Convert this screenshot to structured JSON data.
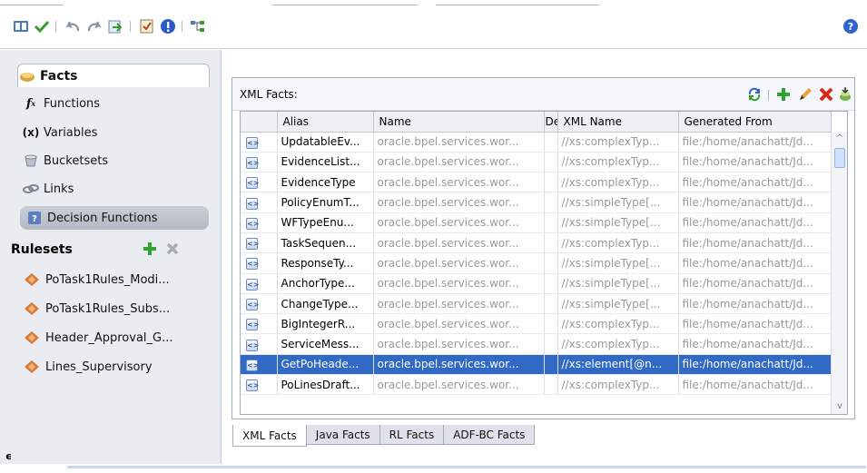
{
  "toolbar": {
    "icons": [
      "book-icon",
      "check-icon",
      "undo-icon",
      "redo-icon",
      "import-icon",
      "validate-icon",
      "info-icon",
      "tree-icon",
      "help-icon"
    ]
  },
  "sidebar": {
    "facts_label": "Facts",
    "items": [
      {
        "label": "Functions",
        "icon": "function-icon"
      },
      {
        "label": "Variables",
        "icon": "variables-icon"
      },
      {
        "label": "Bucketsets",
        "icon": "bucketsets-icon"
      },
      {
        "label": "Links",
        "icon": "links-icon"
      }
    ],
    "decision_functions_label": "Decision Functions",
    "rulesets_label": "Rulesets",
    "rulesets": [
      "PoTask1Rules_Modi...",
      "PoTask1Rules_Subs...",
      "Header_Approval_G...",
      "Lines_Supervisory"
    ],
    "status_glyph": "ϵ"
  },
  "xml_facts": {
    "label": "XML Facts:",
    "columns": [
      "",
      "Alias",
      "Name",
      "De",
      "XML Name",
      "Generated From"
    ],
    "rows": [
      {
        "alias": "UpdatableEv...",
        "name": "oracle.bpel.services.wor...",
        "xml": "//xs:complexTyp...",
        "from": "file:/home/anachatt/Jd..."
      },
      {
        "alias": "EvidenceList...",
        "name": "oracle.bpel.services.wor...",
        "xml": "//xs:complexTyp...",
        "from": "file:/home/anachatt/Jd..."
      },
      {
        "alias": "EvidenceType",
        "name": "oracle.bpel.services.wor...",
        "xml": "//xs:complexTyp...",
        "from": "file:/home/anachatt/Jd..."
      },
      {
        "alias": "PolicyEnumT...",
        "name": "oracle.bpel.services.wor...",
        "xml": "//xs:simpleType[...",
        "from": "file:/home/anachatt/Jd..."
      },
      {
        "alias": "WFTypeEnu...",
        "name": "oracle.bpel.services.wor...",
        "xml": "//xs:simpleType[...",
        "from": "file:/home/anachatt/Jd..."
      },
      {
        "alias": "TaskSequen...",
        "name": "oracle.bpel.services.wor...",
        "xml": "//xs:complexTyp...",
        "from": "file:/home/anachatt/Jd..."
      },
      {
        "alias": "ResponseTy...",
        "name": "oracle.bpel.services.wor...",
        "xml": "//xs:simpleType[...",
        "from": "file:/home/anachatt/Jd..."
      },
      {
        "alias": "AnchorType...",
        "name": "oracle.bpel.services.wor...",
        "xml": "//xs:simpleType[...",
        "from": "file:/home/anachatt/Jd..."
      },
      {
        "alias": "ChangeType...",
        "name": "oracle.bpel.services.wor...",
        "xml": "//xs:simpleType[...",
        "from": "file:/home/anachatt/Jd..."
      },
      {
        "alias": "BigIntegerR...",
        "name": "oracle.bpel.services.wor...",
        "xml": "//xs:complexTyp...",
        "from": "file:/home/anachatt/Jd..."
      },
      {
        "alias": "ServiceMess...",
        "name": "oracle.bpel.services.wor...",
        "xml": "//xs:complexTyp...",
        "from": "file:/home/anachatt/Jd..."
      },
      {
        "alias": "GetPoHeade...",
        "name": "oracle.bpel.services.wor...",
        "xml": "//xs:element[@n...",
        "from": "file:/home/anachatt/Jd...",
        "selected": true
      },
      {
        "alias": "PoLinesDraft...",
        "name": "oracle.bpel.services.wor...",
        "xml": "//xs:complexTyp...",
        "from": "file:/home/anachatt/Jd..."
      }
    ],
    "row_icon_glyph": "<>",
    "scroll_up": "^",
    "scroll_down": "v"
  },
  "tabs": [
    "XML Facts",
    "Java Facts",
    "RL Facts",
    "ADF-BC Facts"
  ],
  "active_tab": "XML Facts",
  "colors": {
    "selection": "#3169c6",
    "add": "#2fa32f",
    "delete": "#d42a1a"
  }
}
